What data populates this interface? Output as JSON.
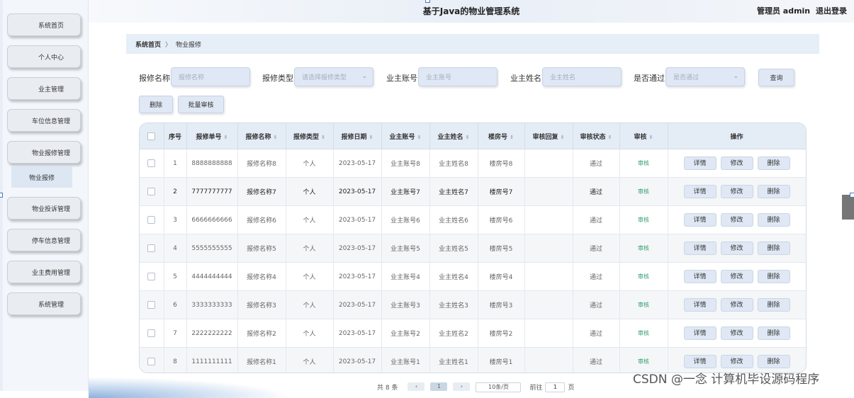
{
  "app_title": "基于Java的物业管理系统",
  "header": {
    "user_label": "管理员 admin",
    "logout_label": "退出登录"
  },
  "sidebar": {
    "items": [
      {
        "label": "系统首页"
      },
      {
        "label": "个人中心"
      },
      {
        "label": "业主管理"
      },
      {
        "label": "车位信息管理"
      },
      {
        "label": "物业报修管理"
      },
      {
        "label": "物业投诉管理"
      },
      {
        "label": "停车信息管理"
      },
      {
        "label": "业主费用管理"
      },
      {
        "label": "系统管理"
      }
    ],
    "active_sub_label": "物业报修"
  },
  "breadcrumb": {
    "home": "系统首页",
    "separator": "〉",
    "current": "物业报修"
  },
  "filters": {
    "repair_name": {
      "label": "报修名称",
      "placeholder": "报修名称"
    },
    "repair_type": {
      "label": "报修类型",
      "placeholder": "请选择报修类型"
    },
    "owner_account": {
      "label": "业主账号",
      "placeholder": "业主账号"
    },
    "owner_name": {
      "label": "业主姓名",
      "placeholder": "业主姓名"
    },
    "approved": {
      "label": "是否通过",
      "placeholder": "是否通过"
    },
    "query_button": "查询"
  },
  "actions": {
    "delete_label": "删除",
    "batch_audit_label": "批量审核"
  },
  "table": {
    "columns": [
      "序号",
      "报修单号",
      "报修名称",
      "报修类型",
      "报修日期",
      "业主账号",
      "业主姓名",
      "楼房号",
      "审核回复",
      "审核状态",
      "审核",
      "操作"
    ],
    "rows": [
      {
        "no": "1",
        "order": "8888888888",
        "name": "报修名称8",
        "type": "个人",
        "date": "2023-05-17",
        "account": "业主账号8",
        "owner": "业主姓名8",
        "room": "楼房号8",
        "reply": "",
        "status": "通过",
        "audit": "审核"
      },
      {
        "no": "2",
        "order": "7777777777",
        "name": "报修名称7",
        "type": "个人",
        "date": "2023-05-17",
        "account": "业主账号7",
        "owner": "业主姓名7",
        "room": "楼房号7",
        "reply": "",
        "status": "通过",
        "audit": "审核"
      },
      {
        "no": "3",
        "order": "6666666666",
        "name": "报修名称6",
        "type": "个人",
        "date": "2023-05-17",
        "account": "业主账号6",
        "owner": "业主姓名6",
        "room": "楼房号6",
        "reply": "",
        "status": "通过",
        "audit": "审核"
      },
      {
        "no": "4",
        "order": "5555555555",
        "name": "报修名称5",
        "type": "个人",
        "date": "2023-05-17",
        "account": "业主账号5",
        "owner": "业主姓名5",
        "room": "楼房号5",
        "reply": "",
        "status": "通过",
        "audit": "审核"
      },
      {
        "no": "5",
        "order": "4444444444",
        "name": "报修名称4",
        "type": "个人",
        "date": "2023-05-17",
        "account": "业主账号4",
        "owner": "业主姓名4",
        "room": "楼房号4",
        "reply": "",
        "status": "通过",
        "audit": "审核"
      },
      {
        "no": "6",
        "order": "3333333333",
        "name": "报修名称3",
        "type": "个人",
        "date": "2023-05-17",
        "account": "业主账号3",
        "owner": "业主姓名3",
        "room": "楼房号3",
        "reply": "",
        "status": "通过",
        "audit": "审核"
      },
      {
        "no": "7",
        "order": "2222222222",
        "name": "报修名称2",
        "type": "个人",
        "date": "2023-05-17",
        "account": "业主账号2",
        "owner": "业主姓名2",
        "room": "楼房号2",
        "reply": "",
        "status": "通过",
        "audit": "审核"
      },
      {
        "no": "8",
        "order": "1111111111",
        "name": "报修名称1",
        "type": "个人",
        "date": "2023-05-17",
        "account": "业主账号1",
        "owner": "业主姓名1",
        "room": "楼房号1",
        "reply": "",
        "status": "通过",
        "audit": "审核"
      }
    ],
    "row_actions": {
      "detail": "详情",
      "edit": "修改",
      "delete": "删除"
    }
  },
  "pagination": {
    "total": "共 8 条",
    "page": "1",
    "page_size": "10条/页",
    "goto_label": "前往",
    "goto_value": "1",
    "page_suffix": "页"
  },
  "watermark": "CSDN @一念 计算机毕设源码程序",
  "colors": {
    "accent_bg": "#dfe8f4",
    "header_bg": "#e4ecf6",
    "audit_green": "#2f9e6e"
  }
}
